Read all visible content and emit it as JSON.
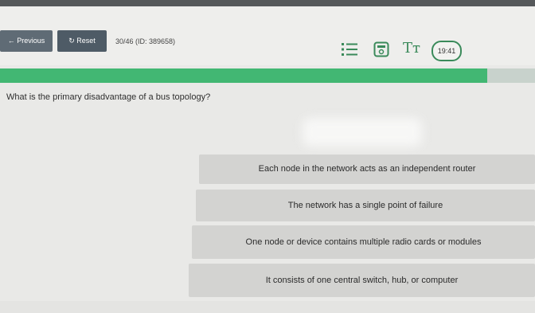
{
  "toolbar": {
    "previous_label": "← Previous",
    "reset_label": "↻ Reset",
    "question_counter": "30/46 (ID: 389658)",
    "timer": "19:41"
  },
  "icons": {
    "list": "list-icon",
    "calculator": "calculator-icon",
    "font_size": "font-size-icon",
    "accent_color": "#3a8a5a"
  },
  "progress": {
    "fraction": 0.91,
    "color": "#42b773"
  },
  "question": {
    "text": "What is the primary disadvantage of a bus topology?"
  },
  "choices": [
    {
      "label": "Each node in the network acts as an independent router"
    },
    {
      "label": "The network has a single point of failure"
    },
    {
      "label": "One node or device contains multiple radio cards or modules"
    },
    {
      "label": "It consists of one central switch, hub, or computer"
    }
  ]
}
